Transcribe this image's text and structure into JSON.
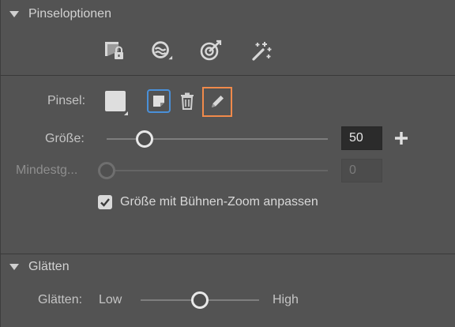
{
  "brush_options": {
    "title": "Pinseloptionen",
    "tool_icons": [
      "lock-brush-icon",
      "brush-mode-icon",
      "target-brush-icon",
      "magic-wand-icon"
    ],
    "brush_label": "Pinsel:",
    "brush_icons": [
      "brush-preview-swatch",
      "new-brush-icon",
      "trash-icon",
      "pencil-icon"
    ],
    "size_label": "Größe:",
    "size_value": "50",
    "size_slider_fraction": 0.17,
    "min_label": "Mindestg...",
    "min_value": "0",
    "min_slider_fraction": 0.0,
    "zoom_checkbox_label": "Größe mit Bühnen-Zoom anpassen",
    "zoom_checkbox_checked": true
  },
  "smoothing": {
    "title": "Glätten",
    "label": "Glätten:",
    "low_label": "Low",
    "high_label": "High",
    "slider_fraction": 0.5
  },
  "colors": {
    "panel_bg": "#535353",
    "highlight_outline": "#f08a4b",
    "selected_button_border": "#4a90d9"
  }
}
